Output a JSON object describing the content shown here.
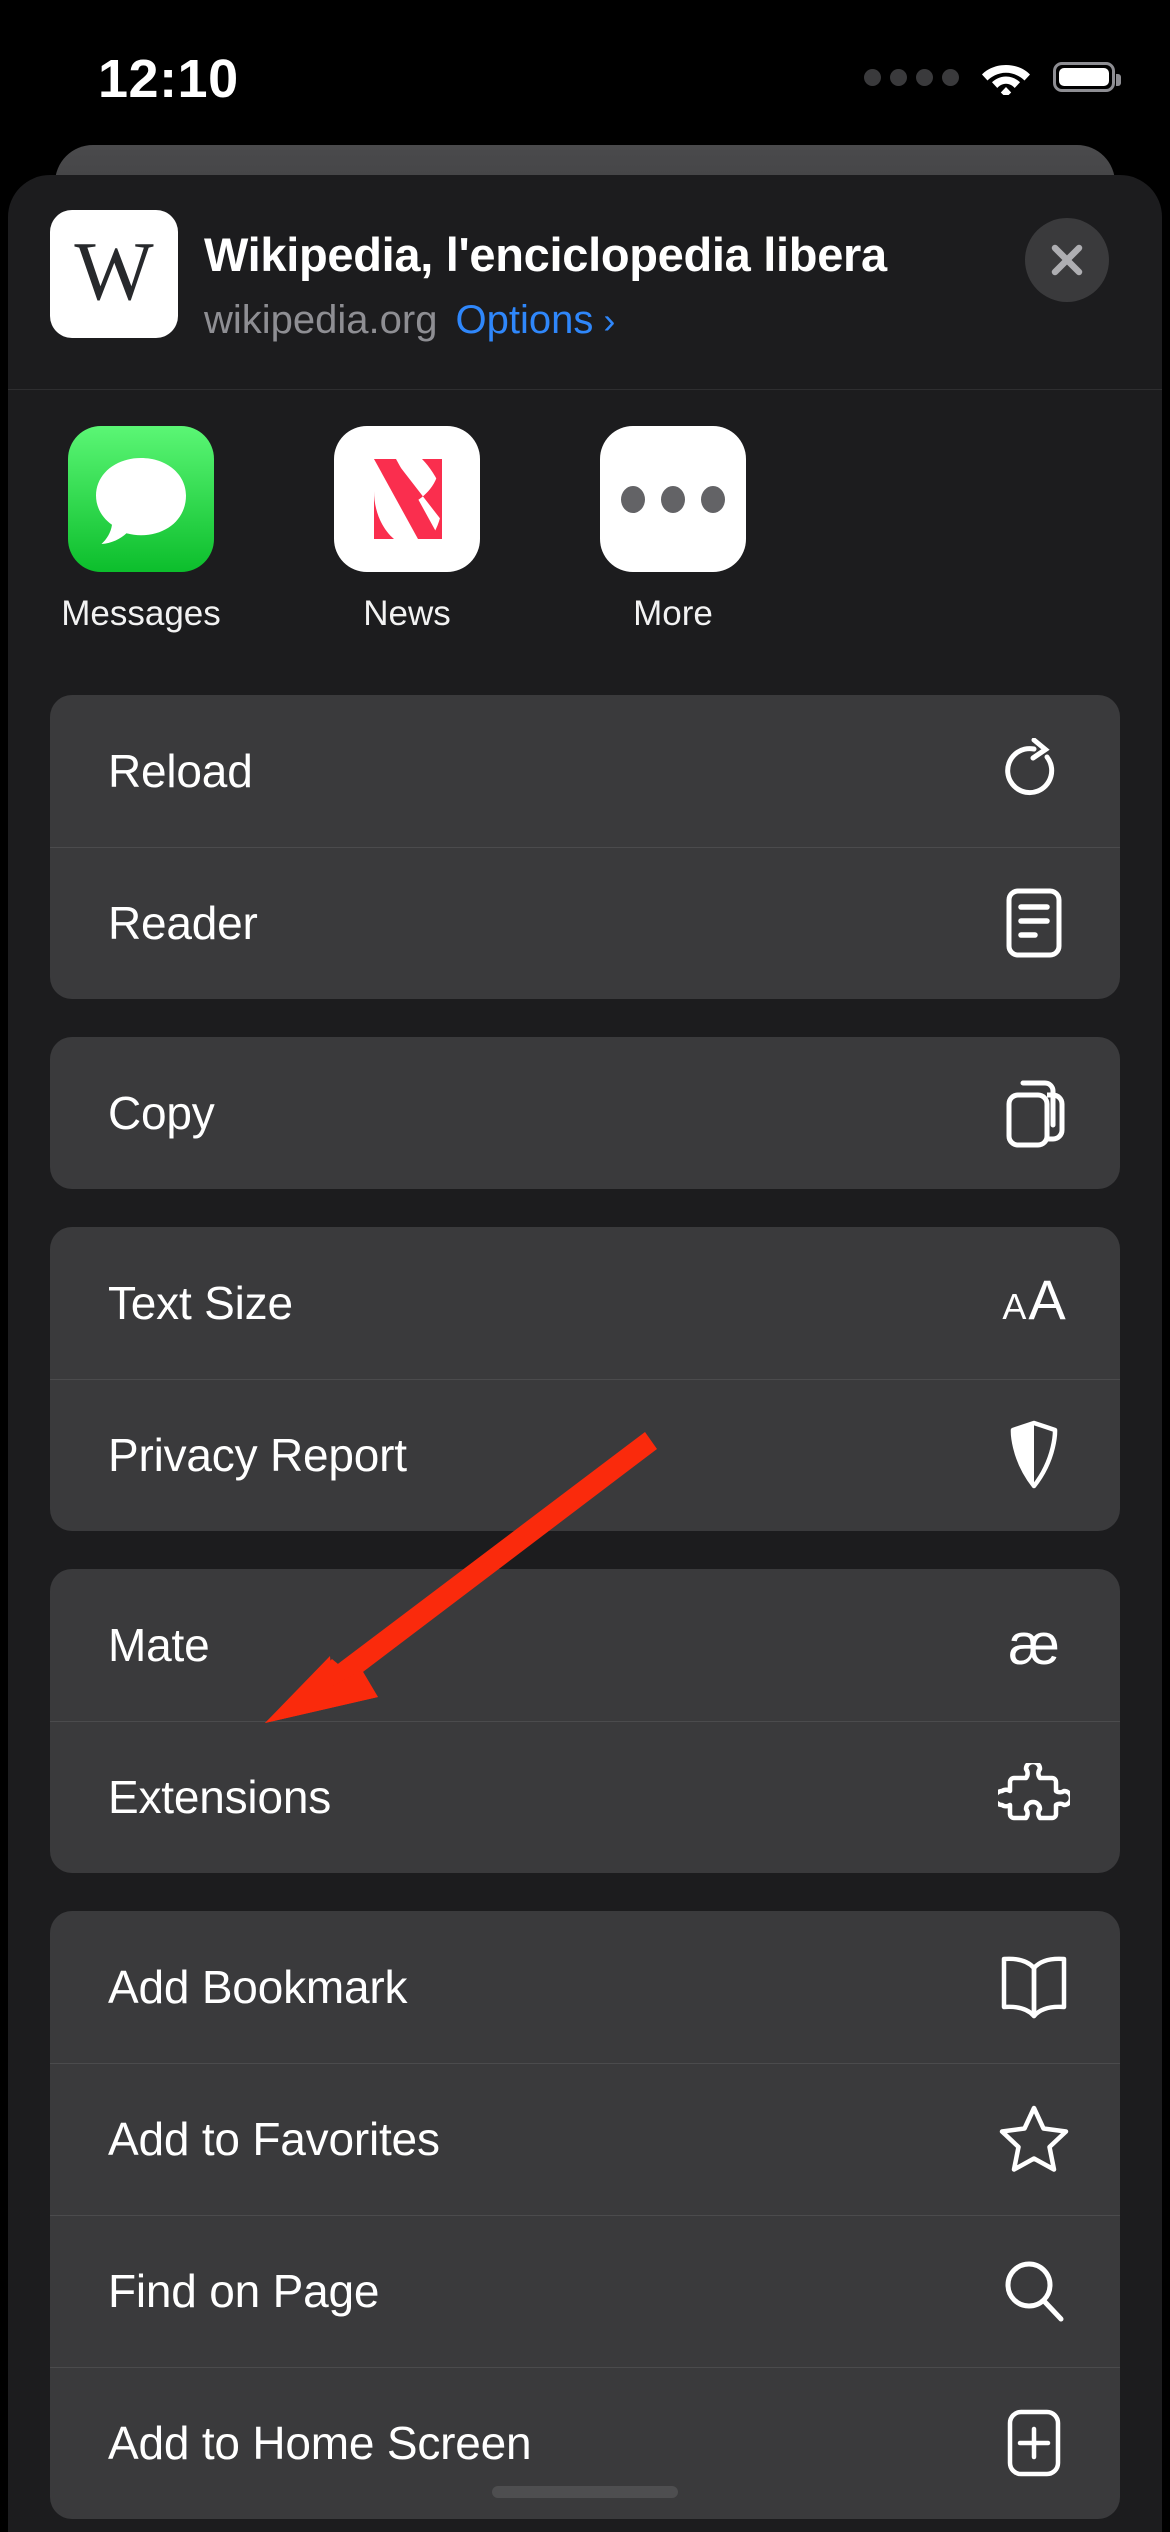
{
  "statusbar": {
    "time": "12:10",
    "cellular_icon": "cellular-dots-icon",
    "wifi_icon": "wifi-icon",
    "battery_icon": "battery-full-icon"
  },
  "header": {
    "favicon_letter": "W",
    "favicon_name": "wikipedia-favicon",
    "title": "Wikipedia, l'enciclopedia libera",
    "domain": "wikipedia.org",
    "options_label": "Options",
    "options_chevron": "›",
    "close_icon": "close-icon"
  },
  "apps": [
    {
      "label": "Messages",
      "icon": "messages-app-icon",
      "color": "#0CBE2C"
    },
    {
      "label": "News",
      "icon": "news-app-icon",
      "color": "#FA2E4E"
    },
    {
      "label": "More",
      "icon": "more-app-icon",
      "color": "#636366"
    }
  ],
  "groups": [
    {
      "name": "page-actions",
      "rows": [
        {
          "label": "Reload",
          "icon": "reload-icon"
        },
        {
          "label": "Reader",
          "icon": "reader-icon"
        }
      ]
    },
    {
      "name": "copy-group",
      "rows": [
        {
          "label": "Copy",
          "icon": "copy-icon"
        }
      ]
    },
    {
      "name": "appearance-privacy",
      "rows": [
        {
          "label": "Text Size",
          "icon": "text-size-icon",
          "glyph_small": "A",
          "glyph_large": "A"
        },
        {
          "label": "Privacy Report",
          "icon": "shield-icon"
        }
      ]
    },
    {
      "name": "extensions-group",
      "rows": [
        {
          "label": "Mate",
          "icon": "mate-icon",
          "glyph": "æ"
        },
        {
          "label": "Extensions",
          "icon": "puzzle-piece-icon"
        }
      ]
    },
    {
      "name": "bookmarks-group",
      "rows": [
        {
          "label": "Add Bookmark",
          "icon": "book-icon"
        },
        {
          "label": "Add to Favorites",
          "icon": "star-icon"
        },
        {
          "label": "Find on Page",
          "icon": "search-icon"
        },
        {
          "label": "Add to Home Screen",
          "icon": "add-to-home-icon"
        }
      ]
    }
  ],
  "annotation": {
    "arrow_color": "#FA2A0C",
    "arrow_name": "red-pointer-arrow",
    "points_at": "Mate"
  },
  "home_indicator": "home-indicator"
}
